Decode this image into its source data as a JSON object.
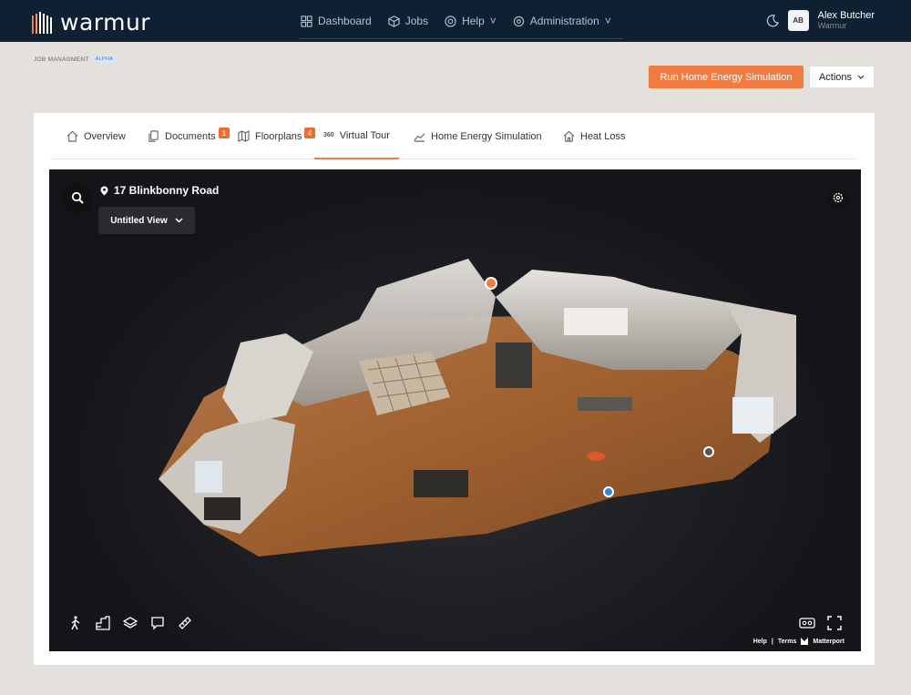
{
  "app": {
    "brand": "warmur"
  },
  "nav": {
    "items": [
      {
        "label": "Dashboard",
        "icon": "dashboard-icon"
      },
      {
        "label": "Jobs",
        "icon": "box-icon"
      },
      {
        "label": "Help",
        "icon": "lifebuoy-icon",
        "caret": "˅"
      },
      {
        "label": "Administration",
        "icon": "gear-icon",
        "caret": "˅"
      }
    ]
  },
  "user": {
    "initials": "AB",
    "name": "Alex Butcher",
    "org": "Warmur"
  },
  "breadcrumb": {
    "label": "JOB MANAGMENT",
    "badge": "ALPHA"
  },
  "toolbar": {
    "run_label": "Run Home Energy Simulation",
    "actions_label": "Actions"
  },
  "tabs": [
    {
      "label": "Overview",
      "icon": "home-icon"
    },
    {
      "label": "Documents",
      "icon": "documents-icon",
      "badge": "1"
    },
    {
      "label": "Floorplans",
      "icon": "map-icon",
      "badge": "4"
    },
    {
      "label": "Virtual Tour",
      "icon": "360-icon",
      "icon_text": "360",
      "active": true
    },
    {
      "label": "Home Energy Simulation",
      "icon": "chart-icon"
    },
    {
      "label": "Heat Loss",
      "icon": "house-heat-icon"
    }
  ],
  "viewer": {
    "address": "17 Blinkbonny Road",
    "view_name": "Untitled View",
    "footer": {
      "help": "Help",
      "sep": "|",
      "terms": "Terms",
      "brand": "Matterport"
    }
  },
  "colors": {
    "nav_bg": "#0f2033",
    "accent": "#f07c42",
    "page_bg": "#e4e1dc"
  }
}
